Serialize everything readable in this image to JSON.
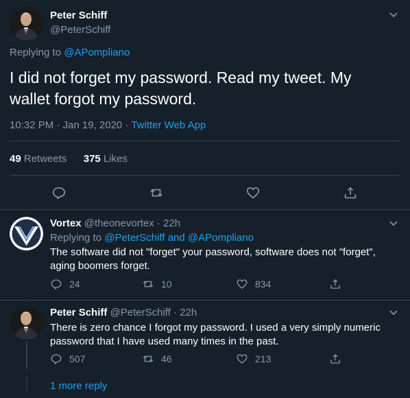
{
  "main_tweet": {
    "name": "Peter Schiff",
    "handle": "@PeterSchiff",
    "replying_prefix": "Replying to",
    "replying_to": "@APompliano",
    "text": "I did not forget my password.  Read my tweet.  My wallet forgot my password.",
    "time": "10:32 PM · Jan 19, 2020 ·",
    "source": "Twitter Web App",
    "retweets_count": "49",
    "retweets_label": "Retweets",
    "likes_count": "375",
    "likes_label": "Likes"
  },
  "replies": [
    {
      "name": "Vortex",
      "handle": "@theonevortex",
      "age": "· 22h",
      "replying_prefix": "Replying to",
      "replying_to": "@PeterSchiff and @APompliano",
      "text": "The software did not \"forget\" your password, software does not \"forget\", aging boomers forget.",
      "replies": "24",
      "retweets": "10",
      "likes": "834"
    },
    {
      "name": "Peter Schiff",
      "handle": "@PeterSchiff",
      "age": "· 22h",
      "text": "There is zero chance I forgot my password.  I used a very simply numeric password that I have used many times in the past.",
      "replies": "507",
      "retweets": "46",
      "likes": "213"
    }
  ],
  "more_replies": "1 more reply",
  "colors": {
    "background": "#15202b",
    "accent": "#1da1f2",
    "muted": "#8899a6",
    "divider": "#38444d"
  }
}
